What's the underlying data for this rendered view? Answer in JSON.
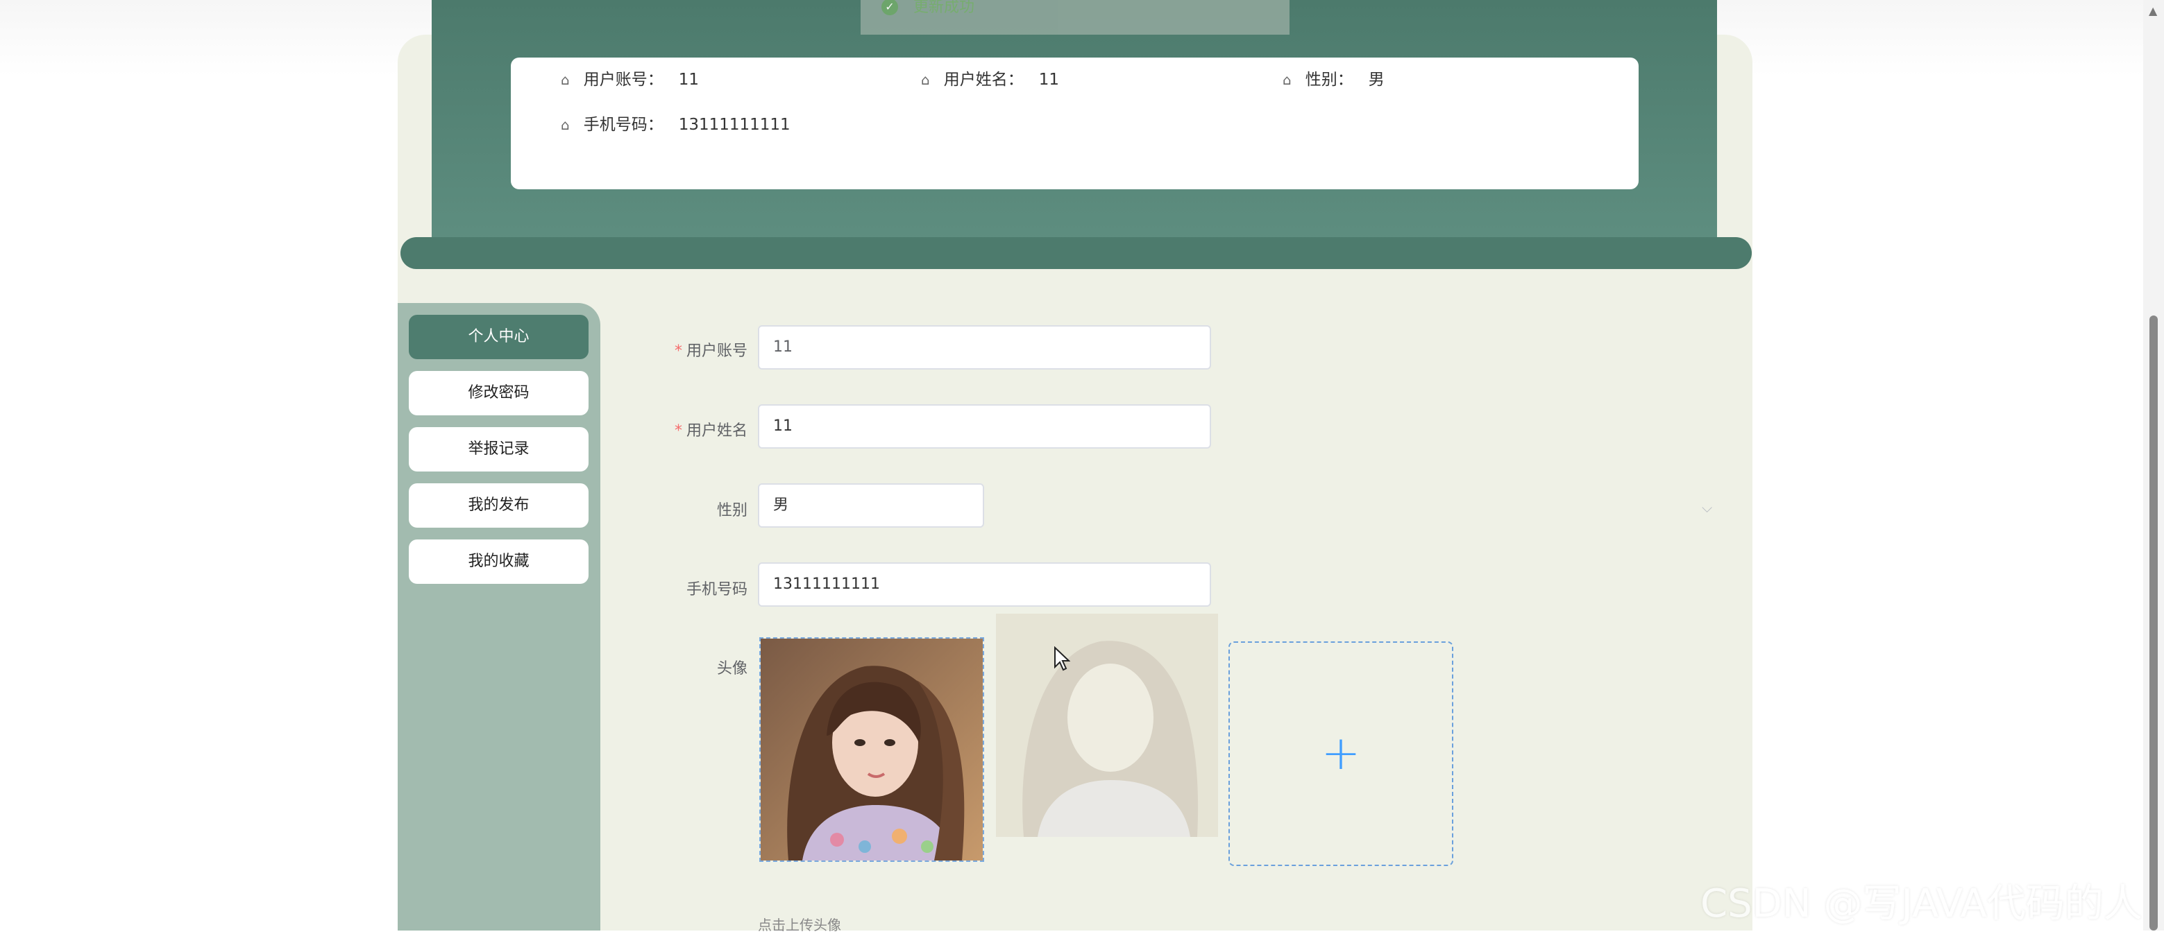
{
  "toast": {
    "text": "更新成功"
  },
  "info_card": {
    "account_label": "用户账号：",
    "account_value": "11",
    "name_label": "用户姓名：",
    "name_value": "11",
    "gender_label": "性别：",
    "gender_value": "男",
    "phone_label": "手机号码：",
    "phone_value": "13111111111"
  },
  "sidebar": {
    "items": [
      {
        "label": "个人中心",
        "active": true
      },
      {
        "label": "修改密码",
        "active": false
      },
      {
        "label": "举报记录",
        "active": false
      },
      {
        "label": "我的发布",
        "active": false
      },
      {
        "label": "我的收藏",
        "active": false
      }
    ]
  },
  "form": {
    "account": {
      "label": "用户账号",
      "value": "11",
      "required": true
    },
    "name": {
      "label": "用户姓名",
      "value": "11",
      "required": true
    },
    "gender": {
      "label": "性别",
      "value": "男"
    },
    "phone": {
      "label": "手机号码",
      "value": "13111111111"
    },
    "avatar": {
      "label": "头像",
      "hint": "点击上传头像"
    }
  },
  "icons": {
    "info": "home-icon",
    "upload": "plus-icon",
    "select": "chevron-down-icon",
    "toast": "check-circle-icon"
  },
  "colors": {
    "primary": "#4e7d6f",
    "sidebar": "#a2bbaf",
    "page": "#eff1e6",
    "upload_accent": "#409eff"
  },
  "watermark": "CSDN @写JAVA代码的人"
}
